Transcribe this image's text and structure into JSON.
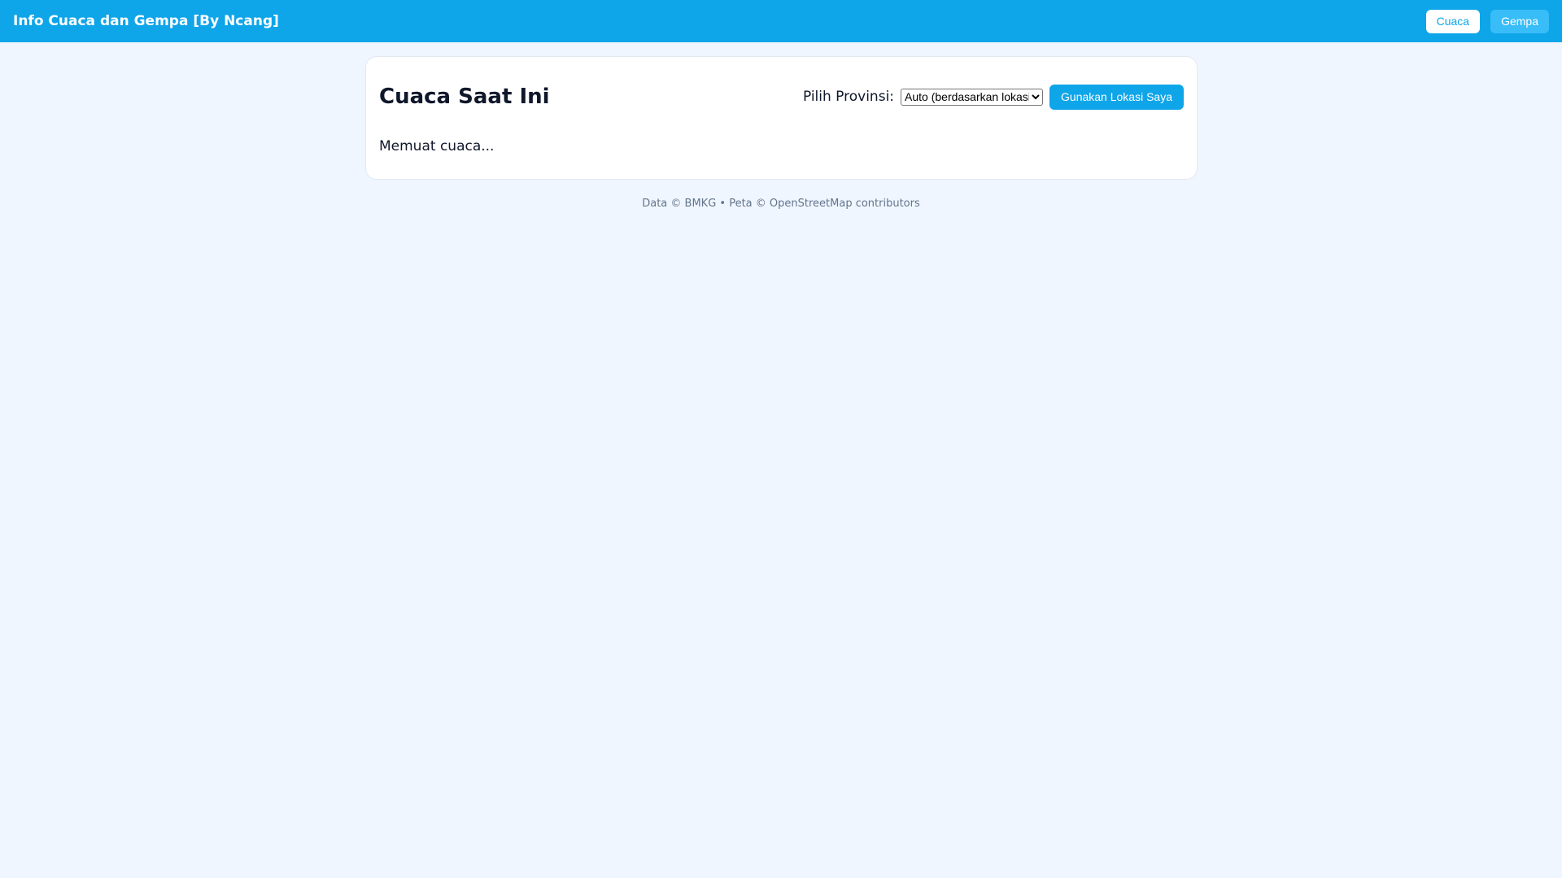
{
  "header": {
    "title": "Info Cuaca dan Gempa [By Ncang]",
    "nav": [
      {
        "label": "Cuaca"
      },
      {
        "label": "Gempa"
      }
    ]
  },
  "card": {
    "title": "Cuaca Saat Ini",
    "province_label": "Pilih Provinsi:",
    "province_selected": "Auto (berdasarkan lokasi)",
    "location_button": "Gunakan Lokasi Saya",
    "status": "Memuat cuaca..."
  },
  "footer": {
    "text": "Data © BMKG • Peta © OpenStreetMap contributors"
  },
  "colors": {
    "accent": "#0ea5e9",
    "background": "#eff6ff"
  }
}
